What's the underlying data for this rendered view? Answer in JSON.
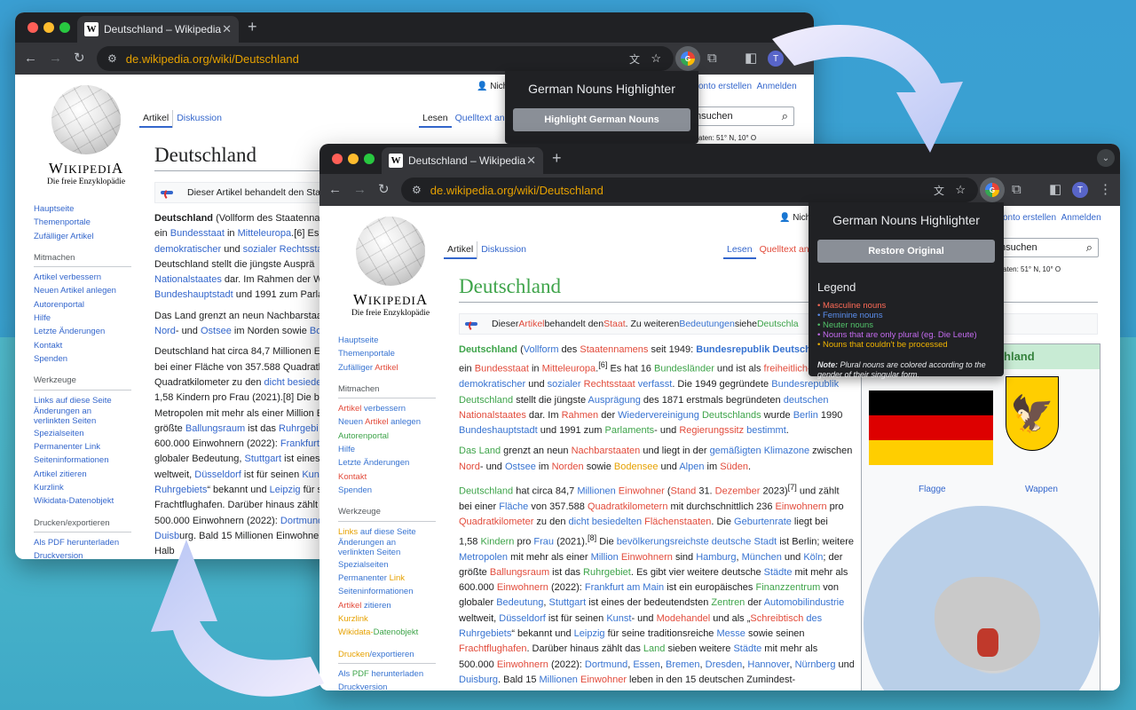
{
  "background_window": {
    "tab_title": "Deutschland – Wikipedia",
    "url": "de.wikipedia.org/wiki/Deutschland",
    "popup": {
      "title": "German Nouns Highlighter",
      "button": "Highlight German Nouns"
    },
    "userbar": "Nicht",
    "userbar_links": [
      "onto erstellen",
      "Anmelden"
    ],
    "tabs": [
      "Artikel",
      "Diskussion"
    ],
    "tabs_right": [
      "Lesen",
      "Quelltext an"
    ],
    "search_placeholder": "nsuchen",
    "coord": "aten: 51° N, 10° O",
    "heading": "Deutschland",
    "hatnote": "Dieser Artikel behandelt den Staa",
    "nav_main": [
      "Hauptseite",
      "Themenportale",
      "Zufälliger Artikel"
    ],
    "nav_mitmachen_title": "Mitmachen",
    "nav_mitmachen": [
      "Artikel verbessern",
      "Neuen Artikel anlegen",
      "Autorenportal",
      "Hilfe",
      "Letzte Änderungen",
      "Kontakt",
      "Spenden"
    ],
    "nav_werkzeuge_title": "Werkzeuge",
    "nav_werkzeuge": [
      "Links auf diese Seite",
      "Änderungen an",
      "verlinkten Seiten",
      "Spezialseiten",
      "Permanenter Link",
      "Seiteninformationen",
      "Artikel zitieren",
      "Kurzlink",
      "Wikidata-Datenobjekt"
    ],
    "nav_drucken_title": "Drucken/exportieren",
    "nav_drucken": [
      "Als PDF herunterladen",
      "Druckversion"
    ],
    "paragraphs": [
      [
        "Deutschland",
        " (Vollform des Staatenna"
      ],
      [
        "ein ",
        "Bundesstaat",
        " in ",
        "Mitteleuropa",
        ".[6] Es"
      ],
      [
        "demokratischer",
        " und ",
        "sozialer Rechtssta"
      ],
      [
        "Deutschland stellt die jüngste Ausprä"
      ],
      [
        "Nationalstaates",
        " dar. Im Rahmen der W"
      ],
      [
        "Bundeshauptstadt",
        " und 1991 zum Parla"
      ]
    ],
    "para2": [
      "Das Land grenzt an neun Nachbarstaa",
      "Nord",
      "- und ",
      "Ostsee",
      " im Norden sowie ",
      "Bo"
    ],
    "para3": [
      "Deutschland hat circa 84,7 Millionen E",
      "bei einer Fläche von 357.588 Quadratk",
      "Quadratkilometer zu den ",
      "dicht besiede",
      "1,58 Kindern pro Frau (2021).[8] Die be",
      "Metropolen mit mehr als einer Million E",
      "größte ",
      "Ballungsraum",
      " ist das ",
      "Ruhrgebi",
      "600.000 Einwohnern (2022): ",
      "Frankfurt",
      "globaler Bedeutung, ",
      "Stuttgart",
      " ist eines",
      "weltweit, ",
      "Düsseldorf",
      " ist für seinen ",
      "Kun",
      "Ruhrgebiets",
      "“ bekannt und ",
      "Leipzig",
      " für s",
      "Frachtflughafen. Darüber hinaus zählt",
      "500.000 Einwohnern (2022): ",
      "Dortmund",
      "Duisb",
      "urg. Bald 15 Millionen Einwohner",
      "Halb"
    ]
  },
  "front_window": {
    "tab_title": "Deutschland – Wikipedia",
    "url": "de.wikipedia.org/wiki/Deutschland",
    "popup": {
      "title": "German Nouns Highlighter",
      "button": "Restore Original",
      "legend_title": "Legend",
      "legend": [
        {
          "label": "Masculine nouns",
          "color": "#ff6b57"
        },
        {
          "label": "Feminine nouns",
          "color": "#5b8ff0"
        },
        {
          "label": "Neuter nouns",
          "color": "#52c36a"
        },
        {
          "label": "Nouns that are only plural (eg. Die Leute)",
          "color": "#c46bf0"
        },
        {
          "label": "Nouns that couldn't be processed",
          "color": "#f0b400"
        }
      ],
      "note_bold": "Note:",
      "note": " Plural nouns are colored according to the gender of their singular form."
    },
    "userbar": "Nicht",
    "userbar_links": [
      "konto erstellen",
      "Anmelden"
    ],
    "tabs": [
      "Artikel",
      "Diskussion"
    ],
    "tabs_right": [
      "Lesen",
      "Quelltext an"
    ],
    "search_placeholder": "nsuchen",
    "coord": "aten: 51° N, 10° O",
    "heading": "Deutschland",
    "hatnote": [
      "Dieser ",
      "Artikel",
      " behandelt den ",
      "Staat",
      ". Zu weiteren ",
      "Bedeutungen",
      " siehe ",
      "Deutschla"
    ],
    "infobox_title": "utschland",
    "flag_caption": "Flagge",
    "arms_caption": "Wappen",
    "nav_main": [
      "Hauptseite",
      "Themenportale",
      "Zufälliger Artikel"
    ],
    "nav_mitmachen_title": "Mitmachen",
    "nav_mitmachen": [
      "Artikel verbessern",
      "Neuen Artikel anlegen",
      "Autorenportal",
      "Hilfe",
      "Letzte Änderungen",
      "Kontakt",
      "Spenden"
    ],
    "nav_werkzeuge_title": "Werkzeuge",
    "nav_werkzeuge": [
      "Links auf diese Seite",
      "Änderungen an",
      "verlinkten Seiten",
      "Spezialseiten",
      "Permanenter Link",
      "Seiteninformationen",
      "Artikel zitieren",
      "Kurzlink",
      "Wikidata-Datenobjekt"
    ],
    "nav_drucken_title": "Drucken/exportieren",
    "nav_drucken": [
      "Als PDF herunterladen",
      "Druckversion"
    ]
  }
}
